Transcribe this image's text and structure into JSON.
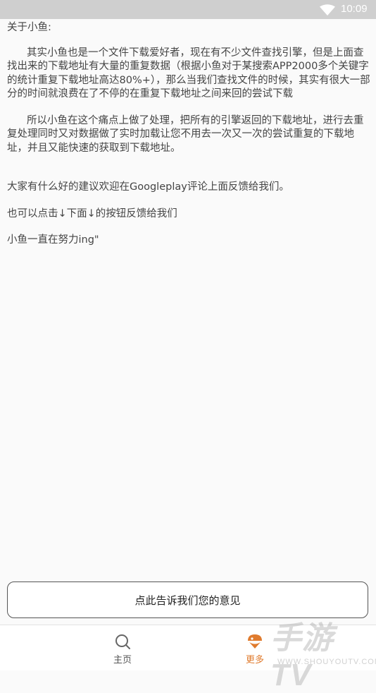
{
  "status_bar": {
    "time": "10:09",
    "wifi_icon": "wifi-icon"
  },
  "about": {
    "title": "关于小鱼:",
    "paragraph1": "其实小鱼也是一个文件下载爱好者，现在有不少文件查找引擎，但是上面查找出来的下载地址有大量的重复数据（根据小鱼对于某搜索APP2000多个关键字的统计重复下载地址高达80%+），那么当我们查找文件的时候，其实有很大一部分的时间就浪费在了不停的在重复下载地址之间来回的尝试下载",
    "paragraph2": "所以小鱼在这个痛点上做了处理，把所有的引擎返回的下载地址，进行去重复处理同时又对数据做了实时加载让您不用去一次又一次的尝试重复的下载地址，并且又能快速的获取到下载地址。",
    "feedback_line": "大家有什么好的建议欢迎在Googleplay评论上面反馈给我们。",
    "click_line": "也可以点击↓下面↓的按钮反馈给我们",
    "sign_line": "小鱼一直在努力ing\""
  },
  "feedback_button": {
    "label": "点此告诉我们您的意见"
  },
  "tabbar": {
    "home": {
      "label": "主页",
      "icon": "search-icon"
    },
    "more": {
      "label": "更多",
      "icon": "fish-icon",
      "active": true
    }
  },
  "colors": {
    "accent": "#e07b2e",
    "status_bar": "#cfcfcf",
    "background": "#fafafa"
  },
  "watermark": {
    "big": "手游TV",
    "small": "WWW.SHOUYOUTV.COM"
  }
}
